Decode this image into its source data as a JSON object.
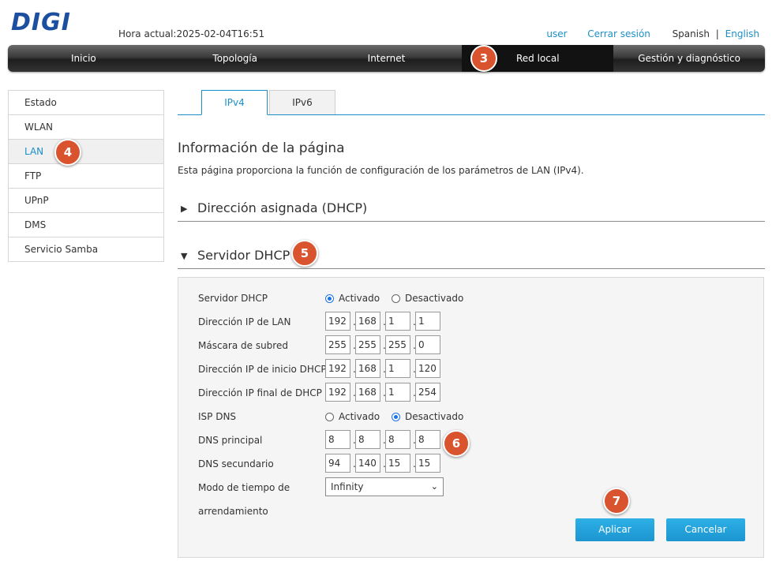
{
  "brand": {
    "logo_text": "DIGI",
    "logo_color": "#1c4fa0"
  },
  "header": {
    "time_label": "Hora actual:2025-02-04T16:51",
    "user": "user",
    "logout": "Cerrar sesión",
    "lang_current": "Spanish",
    "lang_sep": "|",
    "lang_other": "English"
  },
  "nav": {
    "items": [
      "Inicio",
      "Topología",
      "Internet",
      "Red local",
      "Gestión y diagnóstico"
    ],
    "active": "Red local"
  },
  "sidebar": {
    "items": [
      "Estado",
      "WLAN",
      "LAN",
      "FTP",
      "UPnP",
      "DMS",
      "Servicio Samba"
    ],
    "active": "LAN"
  },
  "tabs": {
    "ipv4": "IPv4",
    "ipv6": "IPv6",
    "active": "IPv4"
  },
  "page": {
    "title": "Información de la página",
    "description": "Esta página proporciona la función de configuración de los parámetros de LAN (IPv4)."
  },
  "sections": {
    "dhcp_assigned": "Dirección asignada (DHCP)",
    "dhcp_server": "Servidor DHCP"
  },
  "form": {
    "dhcp_server_label": "Servidor DHCP",
    "dhcp_server_on": "Activado",
    "dhcp_server_off": "Desactivado",
    "dhcp_server_value": "Activado",
    "lan_ip_label": "Dirección IP de LAN",
    "lan_ip": [
      "192",
      "168",
      "1",
      "1"
    ],
    "mask_label": "Máscara de subred",
    "mask": [
      "255",
      "255",
      "255",
      "0"
    ],
    "start_label": "Dirección IP de inicio DHCP",
    "start_ip": [
      "192",
      "168",
      "1",
      "120"
    ],
    "end_label": "Dirección IP final de DHCP",
    "end_ip": [
      "192",
      "168",
      "1",
      "254"
    ],
    "isp_dns_label": "ISP DNS",
    "isp_dns_on": "Activado",
    "isp_dns_off": "Desactivado",
    "isp_dns_value": "Desactivado",
    "dns1_label": "DNS principal",
    "dns1": [
      "8",
      "8",
      "8",
      "8"
    ],
    "dns2_label": "DNS secundario",
    "dns2": [
      "94",
      "140",
      "15",
      "15"
    ],
    "lease_label_1": "Modo de tiempo de",
    "lease_label_2": "arrendamiento",
    "lease_value": "Infinity",
    "dot": "."
  },
  "buttons": {
    "apply": "Aplicar",
    "cancel": "Cancelar"
  },
  "badges": {
    "b3": "3",
    "b4": "4",
    "b5": "5",
    "b6": "6",
    "b7": "7"
  },
  "colors": {
    "accent": "#1c8fc8",
    "badge": "#d9532f",
    "button": "#1c95d0"
  },
  "icons": {
    "collapsed": "triangle-right-icon",
    "expanded": "triangle-down-icon",
    "select": "chevron-down-icon"
  }
}
